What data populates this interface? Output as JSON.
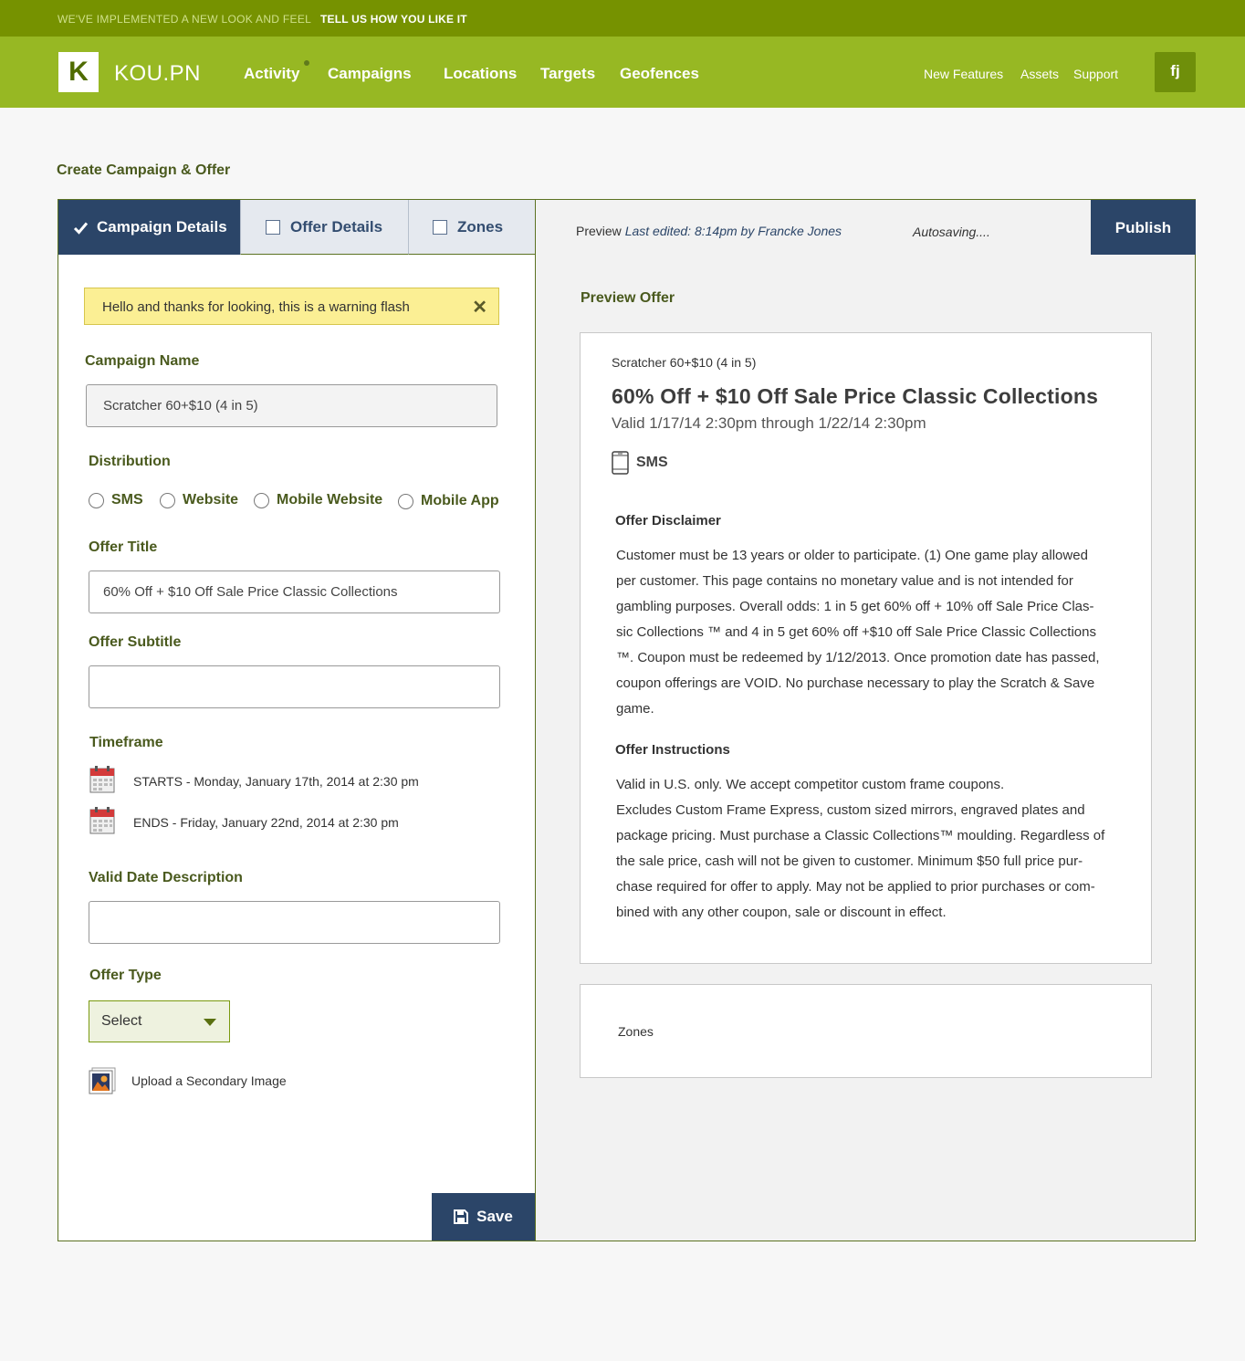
{
  "announcement": {
    "text": "WE'VE IMPLEMENTED A NEW LOOK AND FEEL",
    "link": "TELL US HOW YOU LIKE IT"
  },
  "header": {
    "logo_letter": "K",
    "brand": "KOU.PN",
    "nav": [
      "Activity",
      "Campaigns",
      "Locations",
      "Targets",
      "Geofences"
    ],
    "right_links": [
      "New Features",
      "Assets",
      "Support"
    ],
    "user_initials": "fj"
  },
  "page": {
    "title": "Create Campaign & Offer"
  },
  "tabs": [
    "Campaign Details",
    "Offer Details",
    "Zones"
  ],
  "form": {
    "warning": "Hello and thanks for looking, this is a warning flash",
    "warning_close": "✕",
    "campaign_name_label": "Campaign Name",
    "campaign_name_value": "Scratcher 60+$10 (4 in 5)",
    "distribution_label": "Distribution",
    "distribution_options": [
      "SMS",
      "Website",
      "Mobile Website",
      "Mobile App"
    ],
    "offer_title_label": "Offer Title",
    "offer_title_value": "60% Off + $10 Off Sale Price Classic Collections",
    "offer_subtitle_label": "Offer Subtitle",
    "offer_subtitle_value": "",
    "timeframe_label": "Timeframe",
    "starts": "STARTS - Monday, January 17th, 2014 at 2:30 pm",
    "ends": "ENDS - Friday, January 22nd, 2014 at 2:30 pm",
    "valid_date_label": "Valid Date Description",
    "valid_date_value": "",
    "offer_type_label": "Offer Type",
    "offer_type_value": "Select",
    "upload_label": "Upload a Secondary Image",
    "save_label": "Save"
  },
  "preview": {
    "label": "Preview",
    "last_edited": "Last edited: 8:14pm by Francke Jones",
    "autosave": "Autosaving....",
    "publish": "Publish",
    "section_title": "Preview Offer",
    "offer_subtitle": "Scratcher 60+$10 (4 in 5)",
    "offer_title": "60% Off + $10 Off Sale Price Classic Collections",
    "valid": "Valid 1/17/14 2:30pm through 1/22/14 2:30pm",
    "channel": "SMS",
    "disclaimer_heading": "Offer Disclaimer",
    "disclaimer_lines": [
      "Customer must be 13 years or older to participate. (1) One game play allowed",
      "per customer. This page contains no monetary value and is not intended for",
      "gambling purposes. Overall odds: 1 in 5 get 60% off + 10% off Sale Price Clas-",
      "sic Collections ™ and 4 in 5 get 60% off +$10 off Sale Price Classic Collections",
      "™. Coupon must be redeemed by 1/12/2013. Once promotion date has passed,",
      "coupon offerings are VOID. No purchase necessary to play the Scratch & Save",
      "game."
    ],
    "instructions_heading": "Offer Instructions",
    "instructions_lines": [
      "Valid in U.S. only. We accept competitor custom frame coupons.",
      "Excludes Custom Frame Express, custom sized mirrors, engraved plates and",
      "package pricing. Must purchase a Classic Collections™ moulding. Regardless of",
      "the sale price, cash will not be given to customer. Minimum $50 full price pur-",
      "chase required for offer to apply. May not be applied to prior purchases or com-",
      "bined with any other coupon, sale or discount in effect."
    ],
    "zones_label": "Zones"
  },
  "colors": {
    "announce_bg": "#769200",
    "header_bg": "#97b823",
    "accent_navy": "#2b4568",
    "label_olive": "#4a5a1e",
    "warning_bg": "#fbef94"
  }
}
